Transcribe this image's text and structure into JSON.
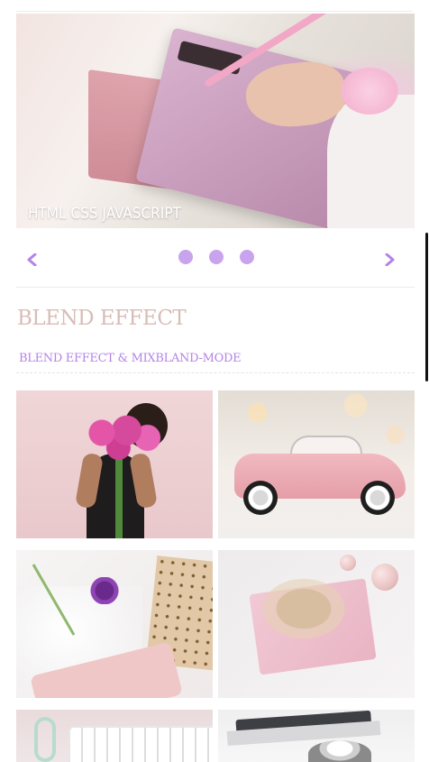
{
  "slider": {
    "caption": "HTML CSS JAVASCRIPT",
    "prev_icon": "chevron-left-icon",
    "next_icon": "chevron-right-icon",
    "dots_count": 3,
    "accent_color": "#b483e6"
  },
  "section": {
    "title": "BLEND EFFECT",
    "subtitle": "BLEND EFFECT & MIXBLAND-MODE"
  },
  "gallery": {
    "items": [
      {
        "name": "woman-with-flowers-image"
      },
      {
        "name": "pink-car-image"
      },
      {
        "name": "flatlay-flowers-image"
      },
      {
        "name": "gift-bow-image"
      },
      {
        "name": "keyboard-image"
      },
      {
        "name": "laptop-cup-image"
      }
    ]
  }
}
